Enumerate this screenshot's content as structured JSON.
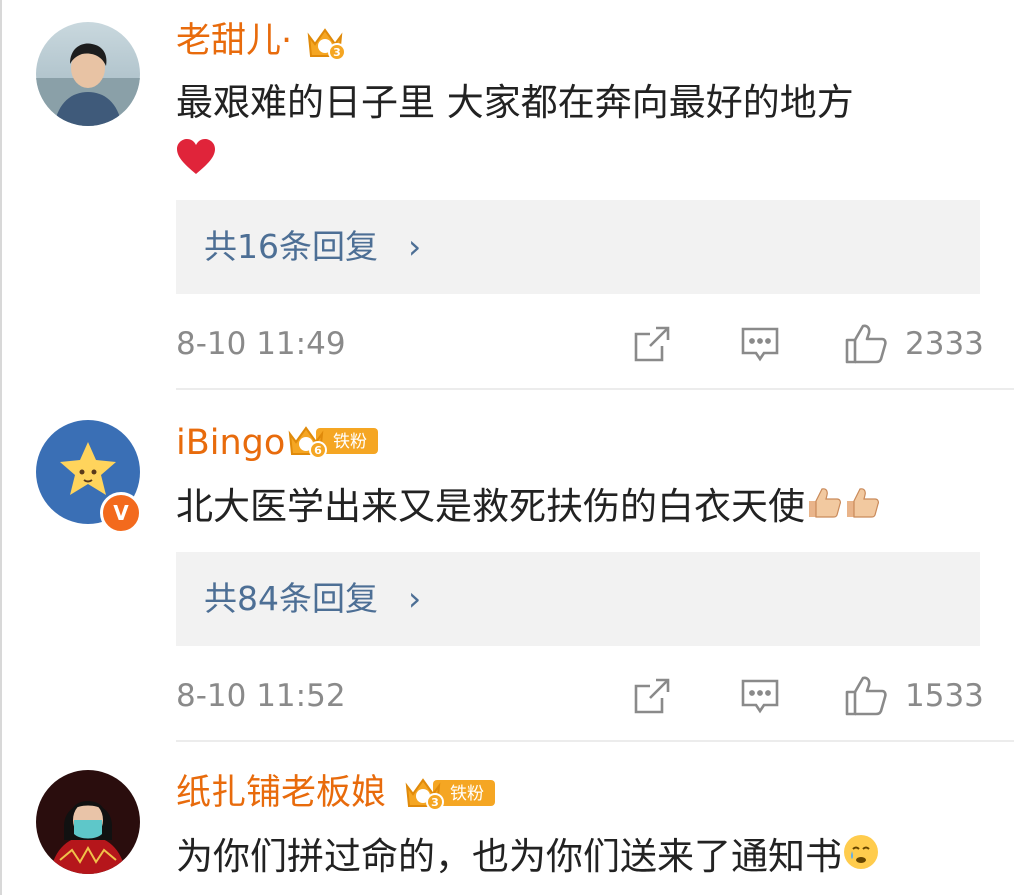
{
  "comments": [
    {
      "username": "老甜儿·",
      "text": "最艰难的日子里 大家都在奔向最好的地方",
      "emoji": "heart-emoji",
      "replies_label": "共16条回复",
      "replies_arrow": "›",
      "timestamp": "8-10 11:49",
      "likes": "2333",
      "badge_level": "3"
    },
    {
      "username": "iBingo",
      "text": "北大医学出来又是救死扶伤的白衣天使",
      "emoji": "thumbs-up-emoji",
      "replies_label": "共84条回复",
      "replies_arrow": "›",
      "timestamp": "8-10 11:52",
      "likes": "1533",
      "badge_level": "6",
      "badge_tag": "铁粉",
      "verified": "V"
    },
    {
      "username": "纸扎铺老板娘",
      "text": "为你们拼过命的，也为你们送来了通知书",
      "emoji": "teary-face-emoji",
      "badge_level": "3",
      "badge_tag": "铁粉"
    }
  ],
  "colors": {
    "username": "#e86b0c",
    "reply_link": "#4d6f95",
    "meta": "#8a8a8a",
    "badge": "#f5a623"
  },
  "icons": {
    "share": "share-icon",
    "comment": "comment-icon",
    "like": "thumbs-up-icon"
  }
}
